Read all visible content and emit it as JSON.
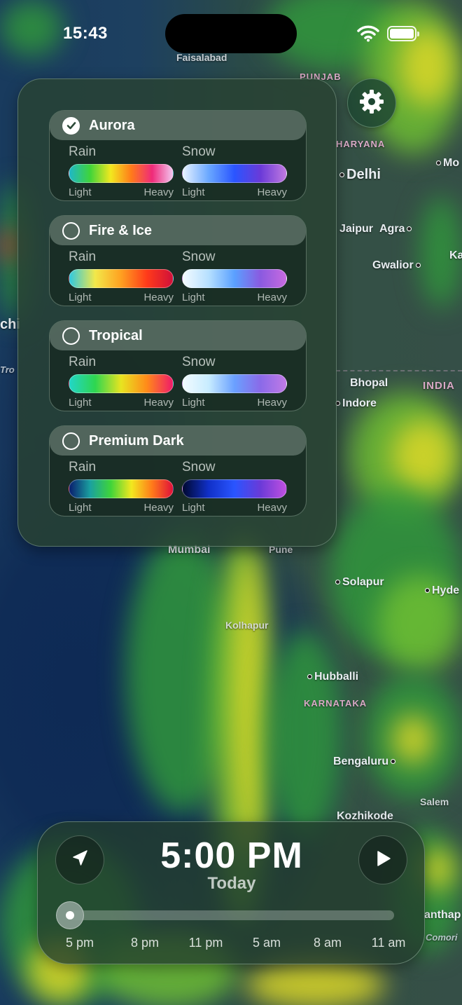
{
  "status_bar": {
    "time": "15:43"
  },
  "map_labels": {
    "faisalabad": "Faisalabad",
    "punjab": "PUNJAB",
    "haryana": "HARYANA",
    "delhi": "Delhi",
    "jaipur": "Jaipur",
    "agra": "Agra",
    "gwalior": "Gwalior",
    "bhopal": "Bhopal",
    "india": "INDIA",
    "indore": "Indore",
    "mumbai": "Mumbai",
    "pune": "Pune",
    "solapur": "Solapur",
    "hyderabad_partial": "Hyde",
    "kolhapur": "Kolhapur",
    "hubballi": "Hubballi",
    "karnataka": "KARNATAKA",
    "bengaluru": "Bengaluru",
    "salem": "Salem",
    "kozhikode": "Kozhikode",
    "anantapur_partial": "anthap",
    "comorin_partial": "Comori",
    "mo_partial": "Mo",
    "ka_partial": "Ka",
    "left_partial": "chi",
    "tro_partial": "Tro"
  },
  "theme_panel": {
    "themes": [
      {
        "name": "Aurora",
        "selected": true,
        "rain": {
          "label": "Rain",
          "light": "Light",
          "heavy": "Heavy",
          "colors": [
            "#1fb7c8",
            "#3fd43a",
            "#f2e81f",
            "#ff7a1a",
            "#ef2a7a",
            "#f3c6f0"
          ]
        },
        "snow": {
          "label": "Snow",
          "light": "Light",
          "heavy": "Heavy",
          "colors": [
            "#e8f2ff",
            "#6aa8ff",
            "#2a55ff",
            "#6a3ad8",
            "#c07ae0"
          ]
        }
      },
      {
        "name": "Fire & Ice",
        "selected": false,
        "rain": {
          "label": "Rain",
          "light": "Light",
          "heavy": "Heavy",
          "colors": [
            "#2fc8e0",
            "#f2e84a",
            "#ffa020",
            "#ff3a1a",
            "#d0103a"
          ]
        },
        "snow": {
          "label": "Snow",
          "light": "Light",
          "heavy": "Heavy",
          "colors": [
            "#f4fbff",
            "#b6e0ff",
            "#5aa0ff",
            "#8a5ae0",
            "#c86ae0"
          ]
        }
      },
      {
        "name": "Tropical",
        "selected": false,
        "rain": {
          "label": "Rain",
          "light": "Light",
          "heavy": "Heavy",
          "colors": [
            "#22d6c8",
            "#2ed650",
            "#e8e420",
            "#ff8a1a",
            "#ef1a6a"
          ]
        },
        "snow": {
          "label": "Snow",
          "light": "Light",
          "heavy": "Heavy",
          "colors": [
            "#f2fbff",
            "#c8ecff",
            "#6aa0ff",
            "#8a6ae8",
            "#c07ae6"
          ]
        }
      },
      {
        "name": "Premium Dark",
        "selected": false,
        "rain": {
          "label": "Rain",
          "light": "Light",
          "heavy": "Heavy",
          "colors": [
            "#0a1e6e",
            "#1aa0a0",
            "#3fd43a",
            "#f2e81f",
            "#ff7a1a",
            "#e0103a"
          ]
        },
        "snow": {
          "label": "Snow",
          "light": "Light",
          "heavy": "Heavy",
          "colors": [
            "#000830",
            "#1030c8",
            "#2a55ff",
            "#6a3ad8",
            "#c050e0"
          ]
        }
      }
    ]
  },
  "timeline": {
    "time": "5:00 PM",
    "day": "Today",
    "progress": 0,
    "ticks": [
      "5 pm",
      "8 pm",
      "11 pm",
      "5 am",
      "8 am",
      "11 am"
    ]
  },
  "icons": {
    "settings": "gear-icon",
    "location": "location-arrow-icon",
    "play": "play-icon",
    "selected": "checkmark-icon",
    "wifi": "wifi-icon",
    "battery": "battery-icon"
  }
}
